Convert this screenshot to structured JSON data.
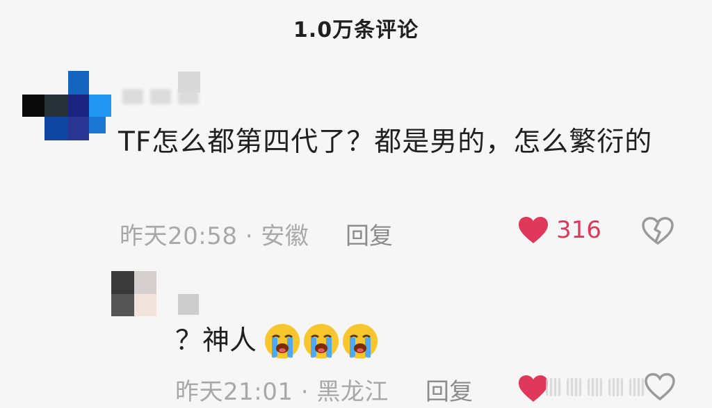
{
  "header": {
    "title": "1.0万条评论"
  },
  "comment": {
    "text": "TF怎么都第四代了？都是男的，怎么繁衍的",
    "meta": "昨天20:58 · 安徽",
    "reply_label": "回复",
    "likes": "316",
    "like_icon": "heart-icon",
    "dislike_icon": "broken-heart-icon"
  },
  "reply": {
    "text": "？神人",
    "emoji": "loudly-crying-face-emoji",
    "emoji_count": 3,
    "meta": "昨天21:01 · 黑龙江",
    "reply_label": "回复",
    "like_icon": "heart-icon",
    "dislike_icon": "broken-heart-icon"
  },
  "colors": {
    "accent": "#e0385a",
    "text": "#202020",
    "muted": "#a8a8a8",
    "background": "#f6f6f6"
  }
}
